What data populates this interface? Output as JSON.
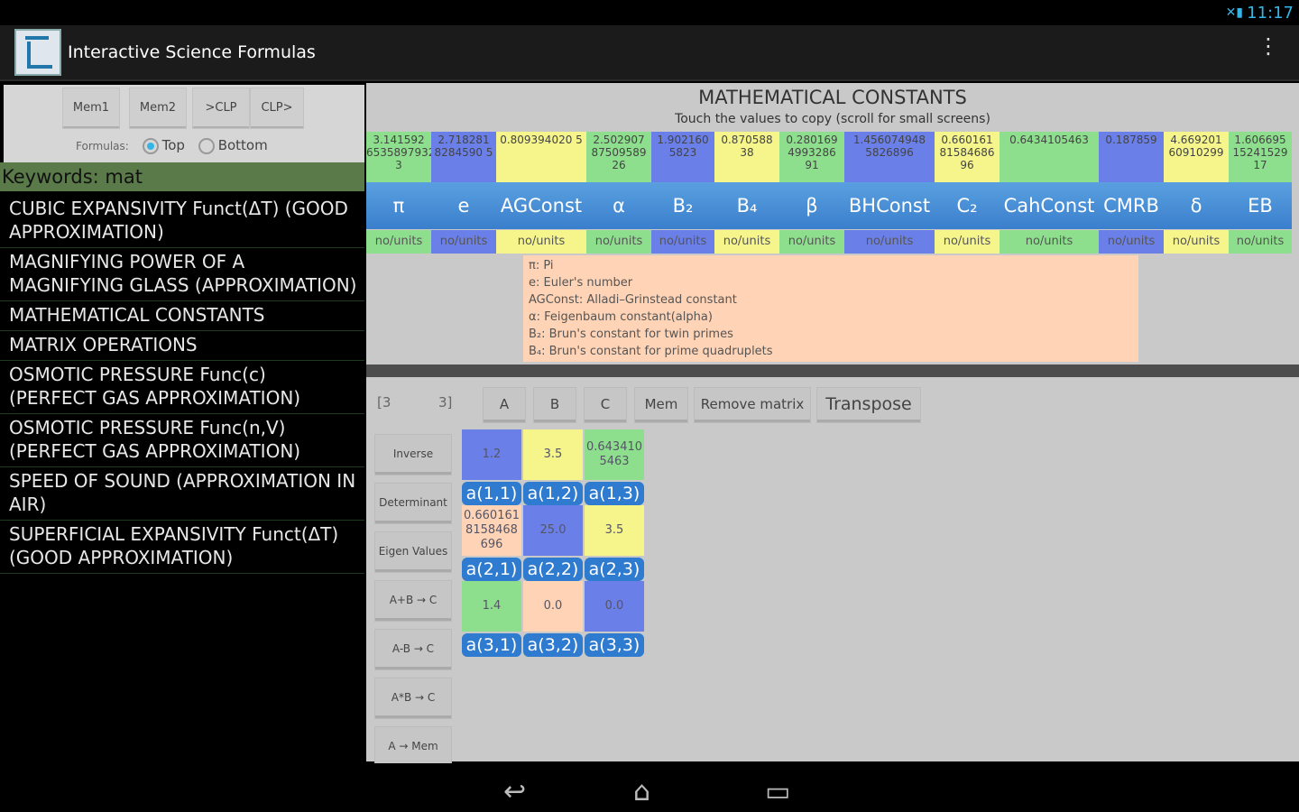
{
  "status": {
    "icons": "✕▮",
    "time": "11:17"
  },
  "app": {
    "title": "Interactive Science Formulas",
    "overflow": "⋮"
  },
  "mem": {
    "buttons": [
      "Mem1",
      "Mem2",
      ">CLP",
      "CLP>"
    ],
    "formulas_label": "Formulas:",
    "top": "Top",
    "bottom": "Bottom"
  },
  "keywords": "Keywords: mat",
  "formula_list": [
    "CUBIC EXPANSIVITY Funct(ΔT) (GOOD APPROXIMATION)",
    "MAGNIFYING POWER OF A MAGNIFYING GLASS (APPROXIMATION)",
    "MATHEMATICAL CONSTANTS",
    "MATRIX OPERATIONS",
    "OSMOTIC PRESSURE Func(c) (PERFECT GAS APPROXIMATION)",
    "OSMOTIC PRESSURE Func(n,V) (PERFECT GAS APPROXIMATION)",
    "SPEED OF SOUND (APPROXIMATION IN AIR)",
    "SUPERFICIAL EXPANSIVITY Funct(ΔT) (GOOD APPROXIMATION)"
  ],
  "constants": {
    "title": "MATHEMATICAL CONSTANTS",
    "subtitle": "Touch the values to copy (scroll for small screens)",
    "values": [
      "3.141592 6535897932 3",
      "2.718281 8284590 5",
      "0.809394020 5",
      "2.502907 87509589 26",
      "1.902160 5823",
      "0.870588 38",
      "0.280169 4993286 91",
      "1.456074948 5826896",
      "0.660161 81584686 96",
      "0.6434105463",
      "0.187859",
      "4.669201 60910299",
      "1.606695 15241529 17"
    ],
    "symbols": [
      "π",
      "e",
      "AGConst",
      "α",
      "B₂",
      "B₄",
      "β",
      "BHConst",
      "C₂",
      "CahConst",
      "CMRB",
      "δ",
      "EB"
    ],
    "units": [
      "no/units",
      "no/units",
      "no/units",
      "no/units",
      "no/units",
      "no/units",
      "no/units",
      "no/units",
      "no/units",
      "no/units",
      "no/units",
      "no/units",
      "no/units"
    ],
    "colors": [
      "#8ddf8d",
      "#6b7fe8",
      "#f5f58c",
      "#8ddf8d",
      "#6b7fe8",
      "#f5f58c",
      "#8ddf8d",
      "#6b7fe8",
      "#f5f58c",
      "#8ddf8d",
      "#6b7fe8",
      "#f5f58c",
      "#8ddf8d"
    ],
    "descriptions": [
      "π: Pi",
      "e: Euler's number",
      "AGConst: Alladi–Grinstead constant",
      "α: Feigenbaum constant(alpha)",
      "B₂: Brun's constant for twin primes",
      "B₄: Brun's constant for prime quadruplets"
    ]
  },
  "matrix": {
    "dim_rows": "[3",
    "dim_cols": "3]",
    "tools": [
      "A",
      "B",
      "C",
      "Mem",
      "Remove matrix",
      "Transpose"
    ],
    "side_buttons": [
      "Inverse",
      "Determinant",
      "Eigen Values",
      "A+B → C",
      "A-B → C",
      "A*B → C",
      "A → Mem"
    ],
    "cells": [
      {
        "value": "1.2",
        "label": "a(1,1)",
        "color": "#6b7fe8"
      },
      {
        "value": "3.5",
        "label": "a(1,2)",
        "color": "#f5f58c"
      },
      {
        "value": "0.643410 5463",
        "label": "a(1,3)",
        "color": "#8ddf8d"
      },
      {
        "value": "0.660161 8158468 696",
        "label": "a(2,1)",
        "color": "#ffd3b5"
      },
      {
        "value": "25.0",
        "label": "a(2,2)",
        "color": "#6b7fe8"
      },
      {
        "value": "3.5",
        "label": "a(2,3)",
        "color": "#f5f58c"
      },
      {
        "value": "1.4",
        "label": "a(3,1)",
        "color": "#8ddf8d"
      },
      {
        "value": "0.0",
        "label": "a(3,2)",
        "color": "#ffd3b5"
      },
      {
        "value": "0.0",
        "label": "a(3,3)",
        "color": "#6b7fe8"
      }
    ]
  },
  "navbar": {
    "back": "↩",
    "home": "⌂",
    "recents": "▭"
  }
}
